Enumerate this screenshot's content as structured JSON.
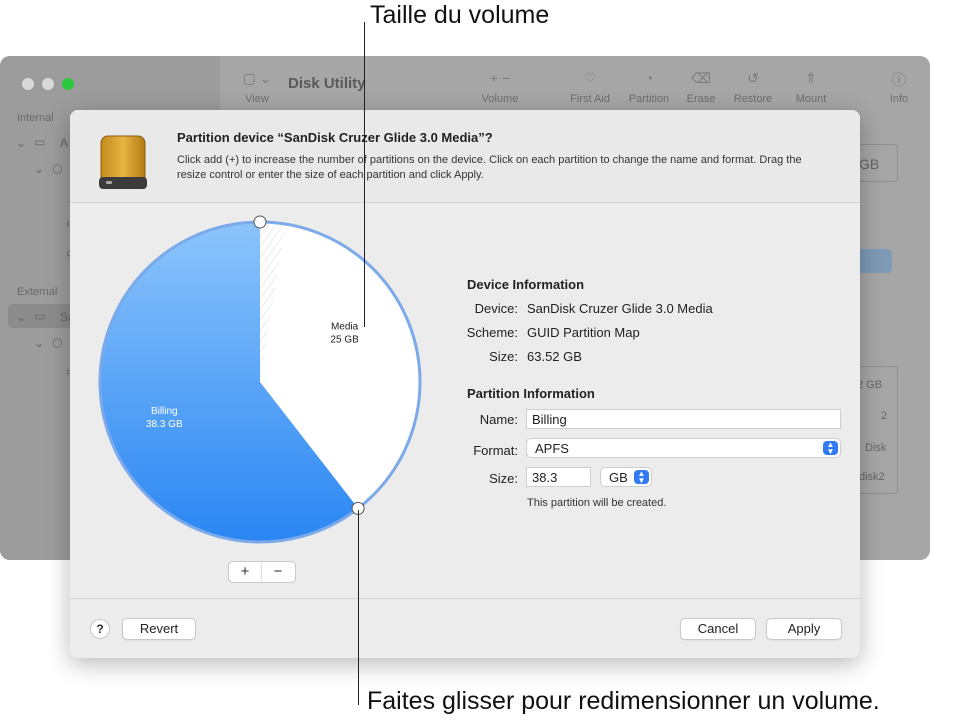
{
  "callouts": {
    "top": "Taille du volume",
    "bottom": "Faites glisser pour redimensionner un volume."
  },
  "window": {
    "title": "Disk Utility",
    "traffic_colors": [
      "#d9d9d9",
      "#d9d9d9",
      "#2bc840"
    ],
    "toolbar": [
      {
        "label": "View",
        "icon": "sidebar-view-icon",
        "glyph": "▢ ⌄"
      },
      {
        "label": "Volume",
        "icon": "add-remove-volume-icon",
        "glyph": "+  −"
      },
      {
        "label": "First Aid",
        "icon": "stethoscope-icon",
        "glyph": "♡"
      },
      {
        "label": "Partition",
        "icon": "pie-partition-icon",
        "glyph": "◔"
      },
      {
        "label": "Erase",
        "icon": "erase-disk-icon",
        "glyph": "⌫"
      },
      {
        "label": "Restore",
        "icon": "restore-icon",
        "glyph": "↺"
      },
      {
        "label": "Mount",
        "icon": "mount-icon",
        "glyph": "⇑"
      },
      {
        "label": "Info",
        "icon": "info-icon",
        "glyph": "ⓘ"
      }
    ],
    "sidebar": {
      "internal_label": "Internal",
      "internal_disk_initial": "A",
      "external_label": "External",
      "external_disk_initial": "Sa"
    },
    "right_partial": {
      "capacity_box": "GB",
      "rows": [
        "2 GB",
        "2",
        "Disk",
        "disk2"
      ]
    }
  },
  "sheet": {
    "title": "Partition device “SanDisk Cruzer Glide 3.0 Media”?",
    "description": "Click add (+) to increase the number of partitions on the device. Click on each partition to change the name and format. Drag the resize control or enter the size of each partition and click Apply.",
    "pie": {
      "partitions": [
        {
          "name": "Billing",
          "size": "38.3 GB",
          "value": 38.3,
          "color": "#3f8ff4"
        },
        {
          "name": "Media",
          "size": "25 GB",
          "value": 25,
          "color": "#ffffff"
        }
      ]
    },
    "add_label": "+",
    "remove_label": "−",
    "device_info": {
      "heading": "Device Information",
      "device_label": "Device:",
      "device_value": "SanDisk Cruzer Glide 3.0 Media",
      "scheme_label": "Scheme:",
      "scheme_value": "GUID Partition Map",
      "size_label": "Size:",
      "size_value": "63.52 GB"
    },
    "partition_info": {
      "heading": "Partition Information",
      "name_label": "Name:",
      "name_value": "Billing",
      "format_label": "Format:",
      "format_value": "APFS",
      "size_label": "Size:",
      "size_value": "38.3",
      "unit_value": "GB",
      "note": "This partition will be created."
    },
    "footer": {
      "help": "?",
      "revert": "Revert",
      "cancel": "Cancel",
      "apply": "Apply"
    }
  }
}
